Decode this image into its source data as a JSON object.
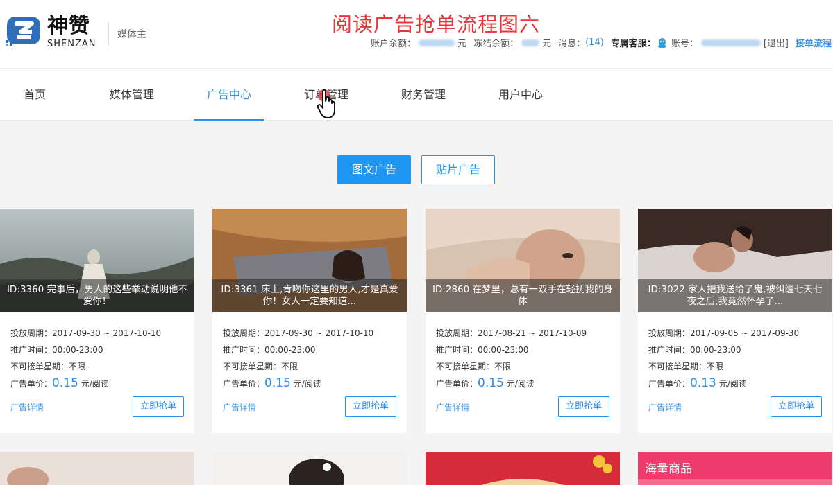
{
  "header": {
    "brand_cn": "神赞",
    "brand_en": "SHENZAN",
    "role": "媒体主",
    "page_title": "阅读广告抢单流程图六",
    "balance_label": "账户余额：",
    "balance_unit": "元",
    "frozen_label": "冻结余额：",
    "frozen_unit": "元",
    "msg_label": "消息：",
    "msg_count": "(14)",
    "service_label": "专属客服：",
    "account_label": "账号：",
    "logout": "[退出]",
    "flow_link": "接单流程"
  },
  "nav": {
    "items": [
      {
        "label": "首页"
      },
      {
        "label": "媒体管理"
      },
      {
        "label": "广告中心"
      },
      {
        "label": "订单管理"
      },
      {
        "label": "财务管理"
      },
      {
        "label": "用户中心"
      }
    ],
    "active": "广告中心"
  },
  "ad_types": {
    "primary": "图文广告",
    "secondary": "贴片广告"
  },
  "labels": {
    "period": "投放周期：",
    "time": "推广时间：",
    "weekday": "不可接单星期：",
    "price": "广告单价：",
    "price_unit": "元/阅读",
    "detail": "广告详情",
    "grab": "立即抢单"
  },
  "cards": [
    {
      "title": "ID:3360 完事后，男人的这些举动说明他不爱你！",
      "period": "2017-09-30 ~ 2017-10-10",
      "time": "00:00-23:00",
      "weekday": "不限",
      "price": "0.15"
    },
    {
      "title": "ID:3361 床上,肯吻你这里的男人,才是真爱你！女人一定要知道...",
      "period": "2017-09-30 ~ 2017-10-10",
      "time": "00:00-23:00",
      "weekday": "不限",
      "price": "0.15"
    },
    {
      "title": "ID:2860 在梦里，总有一双手在轻抚我的身体",
      "period": "2017-08-21 ~ 2017-10-09",
      "time": "00:00-23:00",
      "weekday": "不限",
      "price": "0.15"
    },
    {
      "title": "ID:3022 家人把我送给了鬼,被纠缠七天七夜之后,我竟然怀孕了...",
      "period": "2017-09-05 ~ 2017-09-30",
      "time": "00:00-23:00",
      "weekday": "不限",
      "price": "0.13"
    }
  ],
  "row2": {
    "card4_text": "海量商品"
  },
  "colors": {
    "accent": "#2b8fe8",
    "title_red": "#e8373a"
  }
}
